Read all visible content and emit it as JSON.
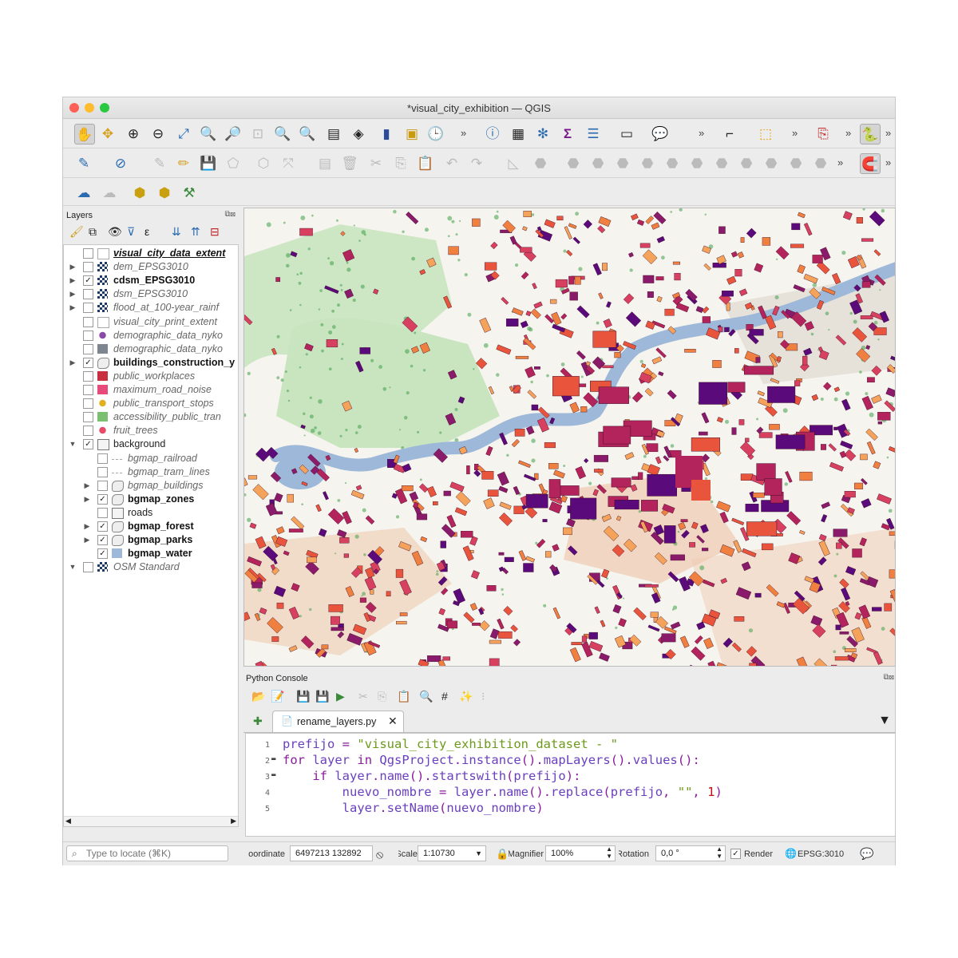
{
  "window": {
    "title": "*visual_city_exhibition — QGIS"
  },
  "toolbar_overflow": "»",
  "layers_panel": {
    "title": "Layers",
    "controls": "⧉⊠",
    "layers": [
      {
        "name": "visual_city_data_extent",
        "checked": false,
        "style": "bold-italic-underline",
        "expandable": false,
        "indent": 0
      },
      {
        "name": "dem_EPSG3010",
        "checked": false,
        "style": "italic",
        "expandable": true,
        "indent": 0
      },
      {
        "name": "cdsm_EPSG3010",
        "checked": true,
        "style": "bold",
        "expandable": true,
        "indent": 0
      },
      {
        "name": "dsm_EPSG3010",
        "checked": false,
        "style": "italic",
        "expandable": true,
        "indent": 0
      },
      {
        "name": "flood_at_100-year_rainf",
        "checked": false,
        "style": "italic",
        "expandable": true,
        "indent": 0
      },
      {
        "name": "visual_city_print_extent",
        "checked": false,
        "style": "italic",
        "expandable": false,
        "indent": 0
      },
      {
        "name": "demographic_data_nyko",
        "checked": false,
        "style": "italic",
        "expandable": false,
        "indent": 0
      },
      {
        "name": "demographic_data_nyko",
        "checked": false,
        "style": "italic",
        "expandable": false,
        "indent": 0
      },
      {
        "name": "buildings_construction_y",
        "checked": true,
        "style": "bold",
        "expandable": true,
        "indent": 0
      },
      {
        "name": "public_workplaces",
        "checked": false,
        "style": "italic",
        "expandable": false,
        "indent": 0
      },
      {
        "name": "maximum_road_noise",
        "checked": false,
        "style": "italic",
        "expandable": false,
        "indent": 0
      },
      {
        "name": "public_transport_stops",
        "checked": false,
        "style": "italic",
        "expandable": false,
        "indent": 0
      },
      {
        "name": "accessibility_public_tran",
        "checked": false,
        "style": "italic",
        "expandable": false,
        "indent": 0
      },
      {
        "name": "fruit_trees",
        "checked": false,
        "style": "italic",
        "expandable": false,
        "indent": 0
      },
      {
        "name": "background",
        "checked": true,
        "style": "normal",
        "expandable": true,
        "expanded": true,
        "indent": 0
      },
      {
        "name": "bgmap_railroad",
        "checked": false,
        "style": "italic",
        "expandable": false,
        "indent": 1
      },
      {
        "name": "bgmap_tram_lines",
        "checked": false,
        "style": "italic",
        "expandable": false,
        "indent": 1
      },
      {
        "name": "bgmap_buildings",
        "checked": false,
        "style": "italic",
        "expandable": true,
        "indent": 1
      },
      {
        "name": "bgmap_zones",
        "checked": true,
        "style": "bold",
        "expandable": true,
        "indent": 1
      },
      {
        "name": "roads",
        "checked": false,
        "style": "normal",
        "expandable": false,
        "indent": 1
      },
      {
        "name": "bgmap_forest",
        "checked": true,
        "style": "bold",
        "expandable": true,
        "indent": 1
      },
      {
        "name": "bgmap_parks",
        "checked": true,
        "style": "bold",
        "expandable": true,
        "indent": 1
      },
      {
        "name": "bgmap_water",
        "checked": true,
        "style": "bold",
        "expandable": false,
        "indent": 1
      },
      {
        "name": "OSM Standard",
        "checked": false,
        "style": "italic",
        "expandable": true,
        "expanded": true,
        "indent": 0
      }
    ]
  },
  "python_console": {
    "title": "Python Console",
    "controls": "⧉⊠",
    "tab_label": "rename_layers.py",
    "close_glyph": "✕",
    "dropdown_glyph": "▼",
    "code_lines": [
      {
        "n": "1",
        "text": "prefijo = \"visual_city_exhibition_dataset - \""
      },
      {
        "n": "2",
        "text": "for layer in QgsProject.instance().mapLayers().values():"
      },
      {
        "n": "3",
        "text": "    if layer.name().startswith(prefijo):"
      },
      {
        "n": "4",
        "text": "        nuevo_nombre = layer.name().replace(prefijo, \"\", 1)"
      },
      {
        "n": "5",
        "text": "        layer.setName(nuevo_nombre)"
      }
    ]
  },
  "status_bar": {
    "locate_placeholder": "Type to locate (⌘K)",
    "coordinate_label": "Coordinate",
    "coordinate_value": "6497213  132892",
    "scale_label": "Scale",
    "scale_value": "1:10730",
    "magnifier_label": "Magnifier",
    "magnifier_value": "100%",
    "rotation_label": "Rotation",
    "rotation_value": "0,0 °",
    "render_label": "Render",
    "crs_label": "EPSG:3010"
  },
  "colors": {
    "water": "#9db8d8",
    "park": "#c9e5c0",
    "forest_dots": "#3fa04a",
    "zone": "#efc9b0",
    "building_low": "#e8553c",
    "building_mid": "#b3245c",
    "building_high": "#5a0a7a",
    "building_old": "#f5a35a"
  }
}
